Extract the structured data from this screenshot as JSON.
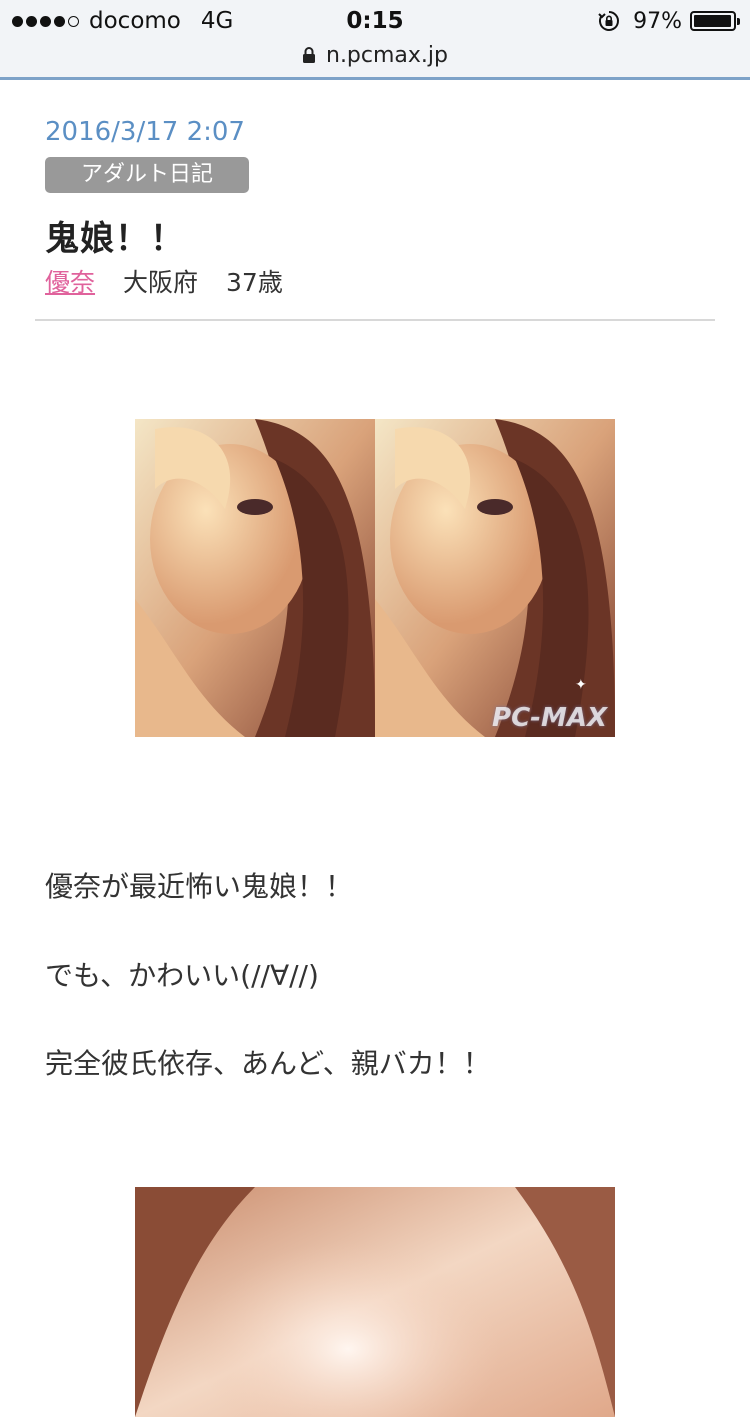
{
  "status_bar": {
    "carrier": "docomo",
    "network": "4G",
    "time": "0:15",
    "battery": "97%",
    "battery_level": 0.97,
    "signal_bars_filled": 4,
    "signal_bars_total": 5
  },
  "url_bar": {
    "url": "n.pcmax.jp"
  },
  "post": {
    "date": "2016/3/17 2:07",
    "category": "アダルト日記",
    "title": "鬼娘！！",
    "author": {
      "name": "優奈",
      "prefecture": "大阪府",
      "age": "37歳"
    },
    "image_watermark": "PC-MAX",
    "body_lines": [
      "優奈が最近怖い鬼娘！！",
      "でも、かわいい(//∀//)",
      "完全彼氏依存、あんど、親バカ！！"
    ]
  },
  "colors": {
    "date": "#5b8fc4",
    "author_link": "#e0629c",
    "badge_bg": "#999999",
    "status_border": "#7ea2c8"
  }
}
